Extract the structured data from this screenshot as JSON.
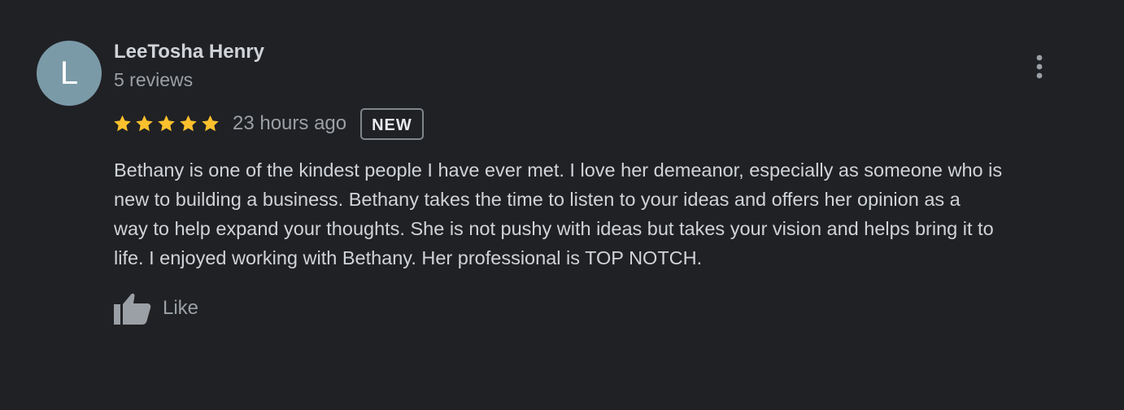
{
  "review": {
    "reviewer_initial": "L",
    "reviewer_name": "LeeTosha Henry",
    "reviewer_review_count": "5 reviews",
    "rating": 5,
    "rating_max": 5,
    "time_ago": "23 hours ago",
    "badge": "NEW",
    "text": "Bethany is one of the kindest people I have ever met.  I love her demeanor, especially as someone who is\nnew to building a business.  Bethany takes the time to listen to your ideas and offers her opinion as a\nway to help expand your thoughts.  She is not pushy with ideas but takes your vision and helps bring it to\nlife.  I enjoyed working with Bethany.  Her professional is TOP NOTCH.",
    "like_label": "Like"
  },
  "icons": {
    "more": "more-vert-icon",
    "star": "star-icon",
    "like": "thumb-up-icon"
  },
  "colors": {
    "background": "#202124",
    "avatar": "#7b9aa8",
    "star": "#fbc02d",
    "secondary_text": "#9aa0a6",
    "primary_text": "#d0d3d7"
  }
}
